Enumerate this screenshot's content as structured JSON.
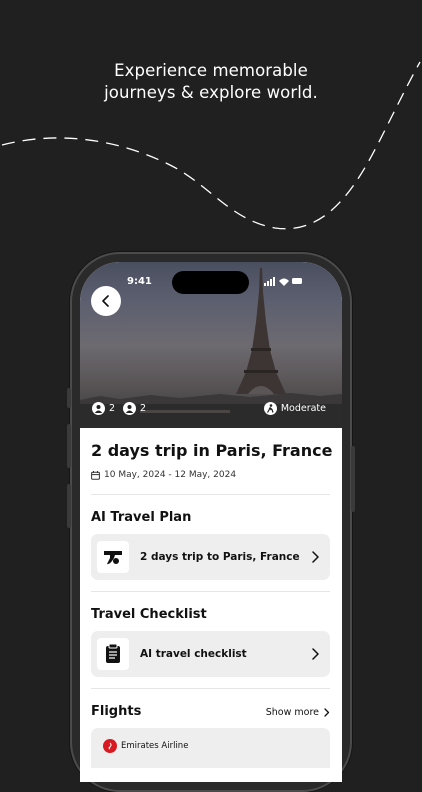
{
  "headline": {
    "line1": "Experience memorable",
    "line2": "journeys & explore world."
  },
  "status_bar": {
    "time": "9:41"
  },
  "hero": {
    "travelers": [
      {
        "icon": "person-icon",
        "count": "2"
      },
      {
        "icon": "person-icon",
        "count": "2"
      }
    ],
    "difficulty": {
      "icon": "walking-icon",
      "label": "Moderate"
    }
  },
  "trip": {
    "title": "2 days trip in Paris, France",
    "dates": "10 May, 2024 - 12 May, 2024"
  },
  "ai_plan": {
    "section_title": "AI Travel Plan",
    "card_label": "2 days trip to Paris, France",
    "icon": "travel-logo-icon"
  },
  "checklist": {
    "section_title": "Travel Checklist",
    "card_label": "AI travel checklist",
    "icon": "clipboard-icon"
  },
  "flights": {
    "section_title": "Flights",
    "show_more": "Show more",
    "airline": "Emirates Airline",
    "airline_color": "#d71a21"
  },
  "colors": {
    "background": "#202020",
    "accent": "#111111",
    "card": "#eeeeee"
  }
}
